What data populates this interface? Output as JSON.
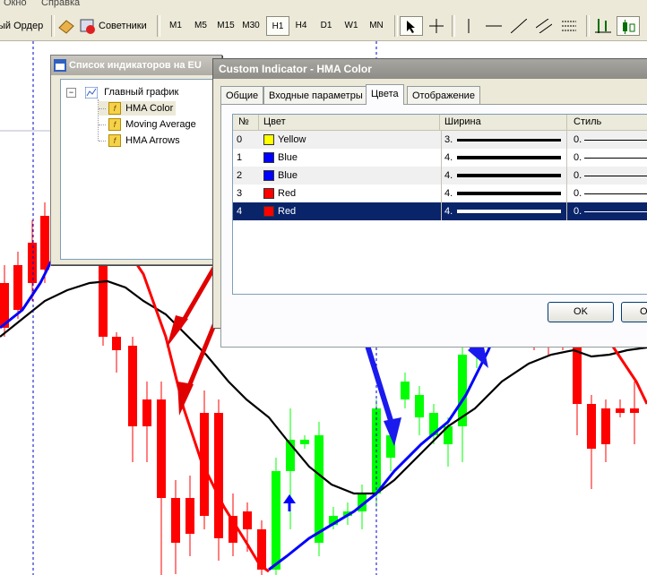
{
  "menu": {
    "window": "Окно",
    "help": "Справка"
  },
  "toolbar": {
    "new_order": "ый Ордер",
    "experts": "Советники",
    "timeframes": [
      "M1",
      "M5",
      "M15",
      "M30",
      "H1",
      "H4",
      "D1",
      "W1",
      "MN"
    ],
    "active_timeframe": "H1"
  },
  "indicator_list": {
    "title": "Список индикаторов на EU",
    "root": "Главный график",
    "items": [
      "HMA Color",
      "Moving Average",
      "HMA Arrows"
    ],
    "selected": "HMA Color"
  },
  "dialog": {
    "title": "Custom Indicator - HMA Color",
    "tabs": [
      "Общие",
      "Входные параметры",
      "Цвета",
      "Отображение"
    ],
    "active_tab": "Цвета",
    "columns": {
      "num": "№",
      "color": "Цвет",
      "width": "Ширина",
      "style": "Стиль"
    },
    "rows": [
      {
        "num": "0",
        "color_name": "Yellow",
        "swatch": "#ffff00",
        "width": "3.",
        "style": "0."
      },
      {
        "num": "1",
        "color_name": "Blue",
        "swatch": "#0000ff",
        "width": "4.",
        "style": "0."
      },
      {
        "num": "2",
        "color_name": "Blue",
        "swatch": "#0000ff",
        "width": "4.",
        "style": "0."
      },
      {
        "num": "3",
        "color_name": "Red",
        "swatch": "#ff0000",
        "width": "4.",
        "style": "0."
      },
      {
        "num": "4",
        "color_name": "Red",
        "swatch": "#ff0000",
        "width": "4.",
        "style": "0."
      }
    ],
    "selected_row": "4",
    "ok": "OK",
    "cancel": "От"
  },
  "colors": {
    "up_candle": "#00ff00",
    "down_candle": "#ff0000",
    "hma_up": "#0000ff",
    "hma_down": "#ff0000",
    "ma": "#000000",
    "arrow": "#0000ff"
  }
}
